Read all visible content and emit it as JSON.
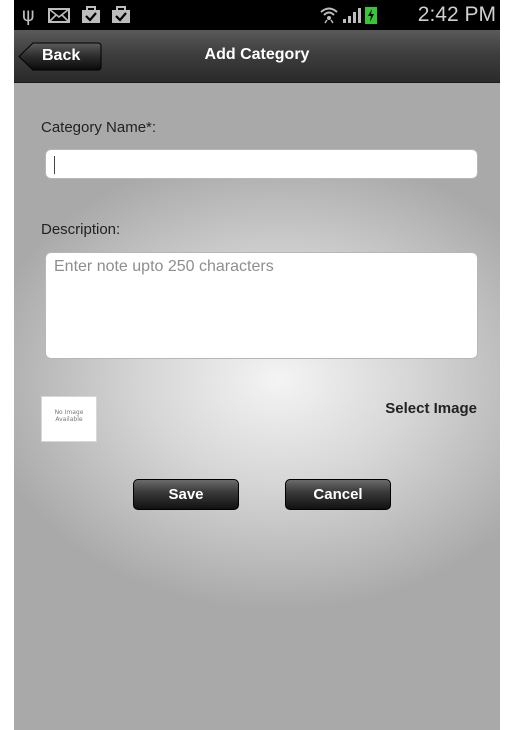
{
  "status_bar": {
    "time": "2:42 PM",
    "icons": [
      "usb-icon",
      "mail-icon",
      "bag-check-icon",
      "bag-check-icon",
      "wifi-icon",
      "signal-icon",
      "battery-charging-icon"
    ]
  },
  "header": {
    "back_label": "Back",
    "title": "Add Category"
  },
  "form": {
    "name_label": "Category Name*:",
    "name_value": "",
    "desc_label": "Description:",
    "desc_placeholder": "Enter note upto 250 characters",
    "image_placeholder_line1": "No Image",
    "image_placeholder_line2": "Available",
    "select_image_label": "Select Image"
  },
  "actions": {
    "save_label": "Save",
    "cancel_label": "Cancel"
  },
  "colors": {
    "title_bar": "#3e3e3e",
    "status_bar": "#000000",
    "button_bg": "#222222",
    "battery": "#38c538"
  }
}
